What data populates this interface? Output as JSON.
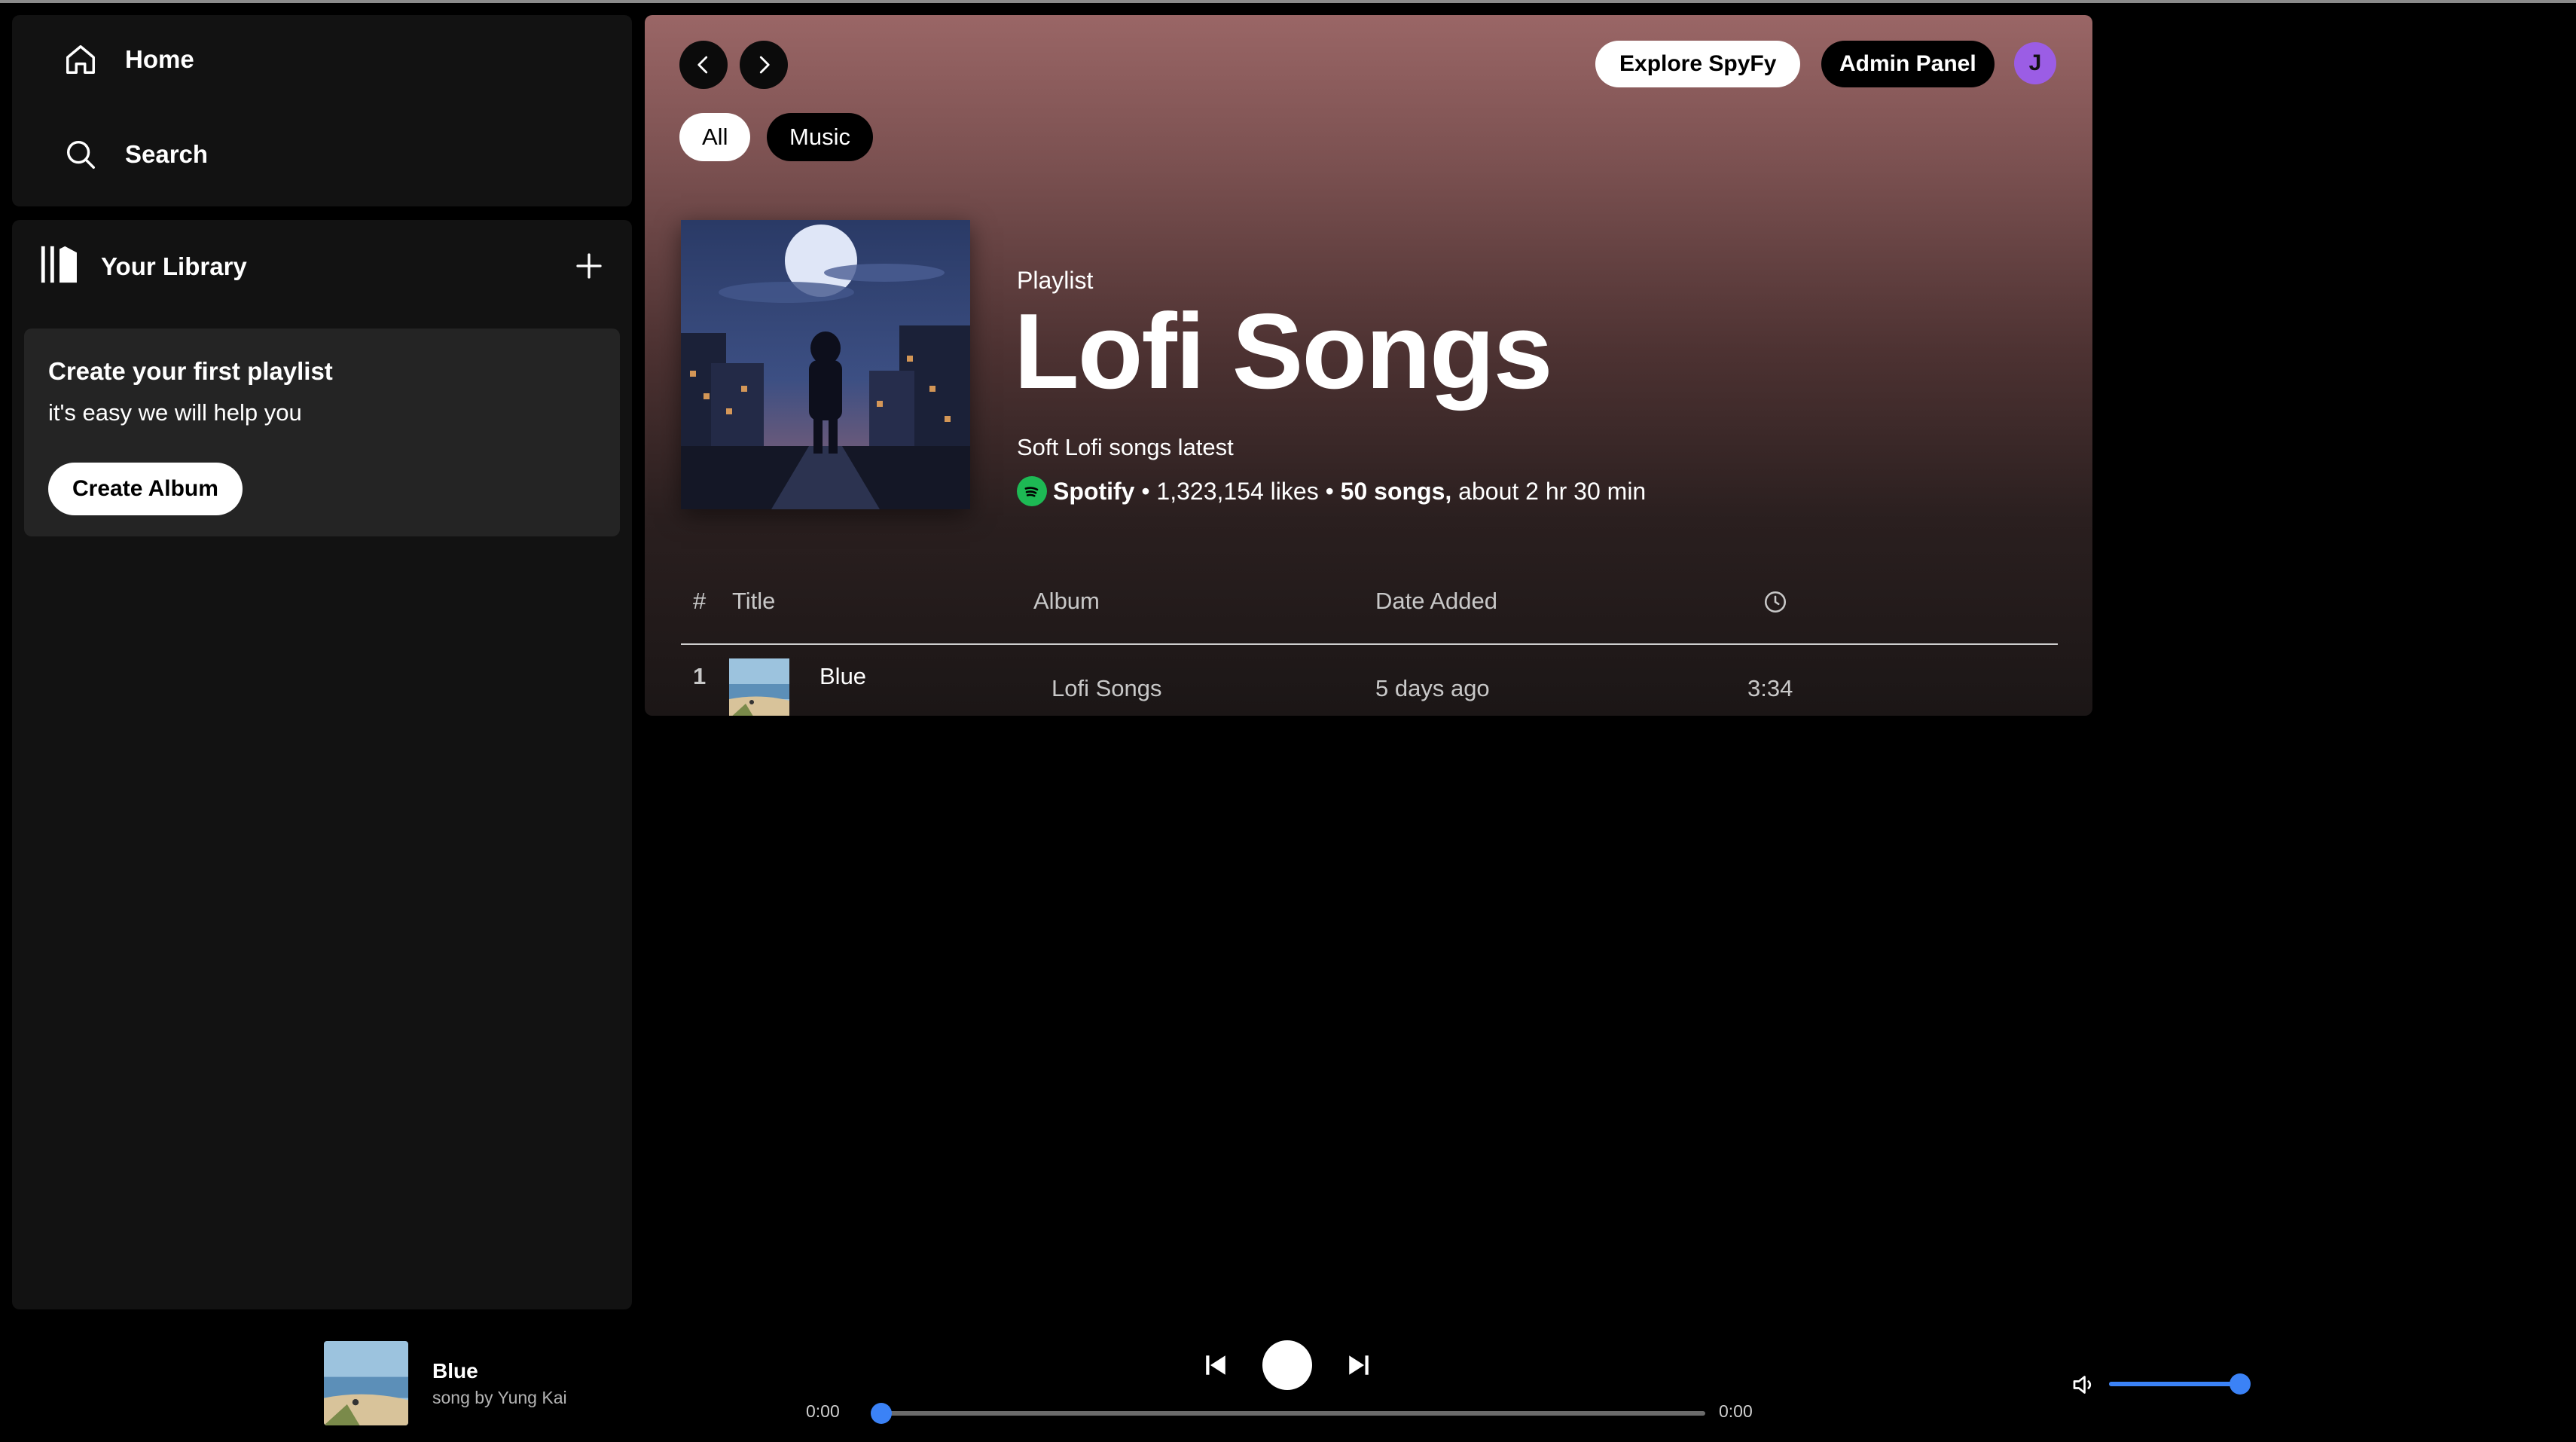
{
  "nav": {
    "home_label": "Home",
    "search_label": "Search"
  },
  "library": {
    "title": "Your Library",
    "card_title": "Create your first playlist",
    "card_subtitle": "it's easy we will help you",
    "create_button": "Create Album"
  },
  "header": {
    "explore_button": "Explore SpyFy",
    "admin_button": "Admin Panel",
    "avatar_initial": "J",
    "filters": [
      "All",
      "Music"
    ]
  },
  "playlist": {
    "type": "Playlist",
    "title": "Lofi Songs",
    "description": "Soft Lofi songs latest",
    "owner": "Spotify",
    "likes": "1,323,154 likes",
    "song_count": "50 songs,",
    "duration": "about 2 hr 30 min"
  },
  "table": {
    "headers": {
      "index": "#",
      "title": "Title",
      "album": "Album",
      "date_added": "Date Added",
      "duration_icon": "clock-icon"
    },
    "rows": [
      {
        "index": "1",
        "title": "Blue",
        "album": "Lofi Songs",
        "date_added": "5 days ago",
        "duration": "3:34"
      }
    ]
  },
  "player": {
    "title": "Blue",
    "artist": "song by Yung Kai",
    "elapsed": "0:00",
    "total": "0:00",
    "progress": 0,
    "volume": 1
  },
  "colors": {
    "accent": "#3b82f6",
    "spotify_green": "#1db954",
    "avatar": "#9b5de5"
  }
}
